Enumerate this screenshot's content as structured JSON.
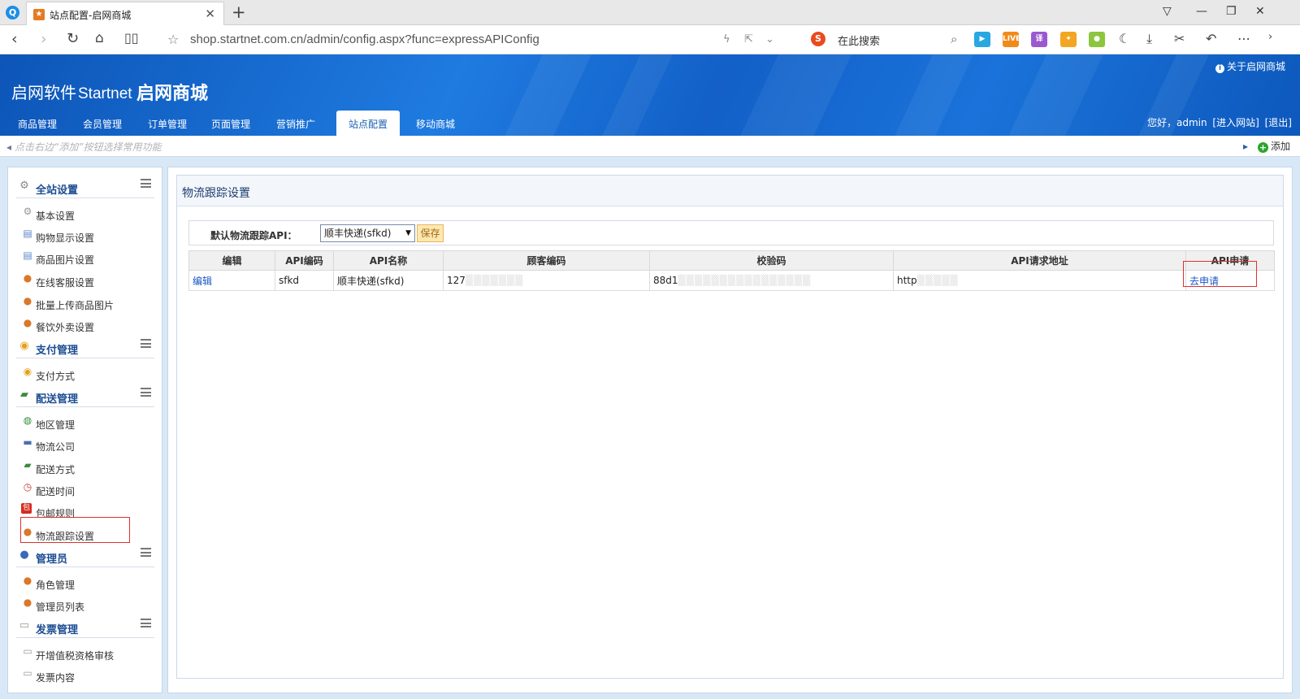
{
  "browser": {
    "tab_title": "站点配置-启网商城",
    "url": "shop.startnet.com.cn/admin/config.aspx?func=expressAPIConfig",
    "search_placeholder": "在此搜索",
    "ext_live_label": "LIVE",
    "ext_translate_label": "译"
  },
  "header": {
    "about_link": "关于启网商城",
    "brand_cn": "启网软件",
    "brand_en": "Startnet",
    "app_name": "启网商城",
    "nav": [
      {
        "label": "商品管理"
      },
      {
        "label": "会员管理"
      },
      {
        "label": "订单管理"
      },
      {
        "label": "页面管理"
      },
      {
        "label": "营销推广"
      },
      {
        "label": "站点配置"
      },
      {
        "label": "移动商城"
      }
    ],
    "greeting": "您好，admin",
    "enter_site": "[进入网站]",
    "logout": "[退出]"
  },
  "quickbar": {
    "hint": "点击右边“添加”按钮选择常用功能",
    "add_label": "添加"
  },
  "sidebar": {
    "sections": [
      {
        "title": "全站设置",
        "icon": "gear-icon",
        "items": [
          {
            "label": "基本设置",
            "icon": "gear-icon"
          },
          {
            "label": "购物显示设置",
            "icon": "page-icon"
          },
          {
            "label": "商品图片设置",
            "icon": "page-icon"
          },
          {
            "label": "在线客服设置",
            "icon": "user-icon"
          },
          {
            "label": "批量上传商品图片",
            "icon": "user-icon"
          },
          {
            "label": "餐饮外卖设置",
            "icon": "user-icon"
          }
        ]
      },
      {
        "title": "支付管理",
        "icon": "coins-icon",
        "items": [
          {
            "label": "支付方式",
            "icon": "coins-icon"
          }
        ]
      },
      {
        "title": "配送管理",
        "icon": "truck-icon",
        "items": [
          {
            "label": "地区管理",
            "icon": "globe-icon"
          },
          {
            "label": "物流公司",
            "icon": "car-icon"
          },
          {
            "label": "配送方式",
            "icon": "truck-icon"
          },
          {
            "label": "配送时间",
            "icon": "clock-icon"
          },
          {
            "label": "包邮规则",
            "icon": "package-icon"
          },
          {
            "label": "物流跟踪设置",
            "icon": "users-icon"
          }
        ]
      },
      {
        "title": "管理员",
        "icon": "user-icon",
        "items": [
          {
            "label": "角色管理",
            "icon": "users-icon"
          },
          {
            "label": "管理员列表",
            "icon": "users-icon"
          }
        ]
      },
      {
        "title": "发票管理",
        "icon": "document-icon",
        "items": [
          {
            "label": "开增值税资格审核",
            "icon": "document-icon"
          },
          {
            "label": "发票内容",
            "icon": "document-icon"
          }
        ]
      }
    ]
  },
  "content": {
    "title": "物流跟踪设置",
    "default_api_label": "默认物流跟踪API：",
    "default_api_value": "顺丰快递(sfkd)",
    "save_label": "保存",
    "columns": [
      "编辑",
      "API编码",
      "API名称",
      "顾客编码",
      "校验码",
      "API请求地址",
      "API申请"
    ],
    "rows": [
      {
        "edit": "编辑",
        "code": "sfkd",
        "name": "顺丰快递(sfkd)",
        "customer_code": "127",
        "check_code": "88d1",
        "request_url": "http",
        "apply": "去申请"
      }
    ]
  },
  "colors": {
    "header_blue": "#1565cf",
    "link_blue": "#1a55c8",
    "highlight_red": "#e03030",
    "workspace_bg": "#d8e8f6"
  }
}
